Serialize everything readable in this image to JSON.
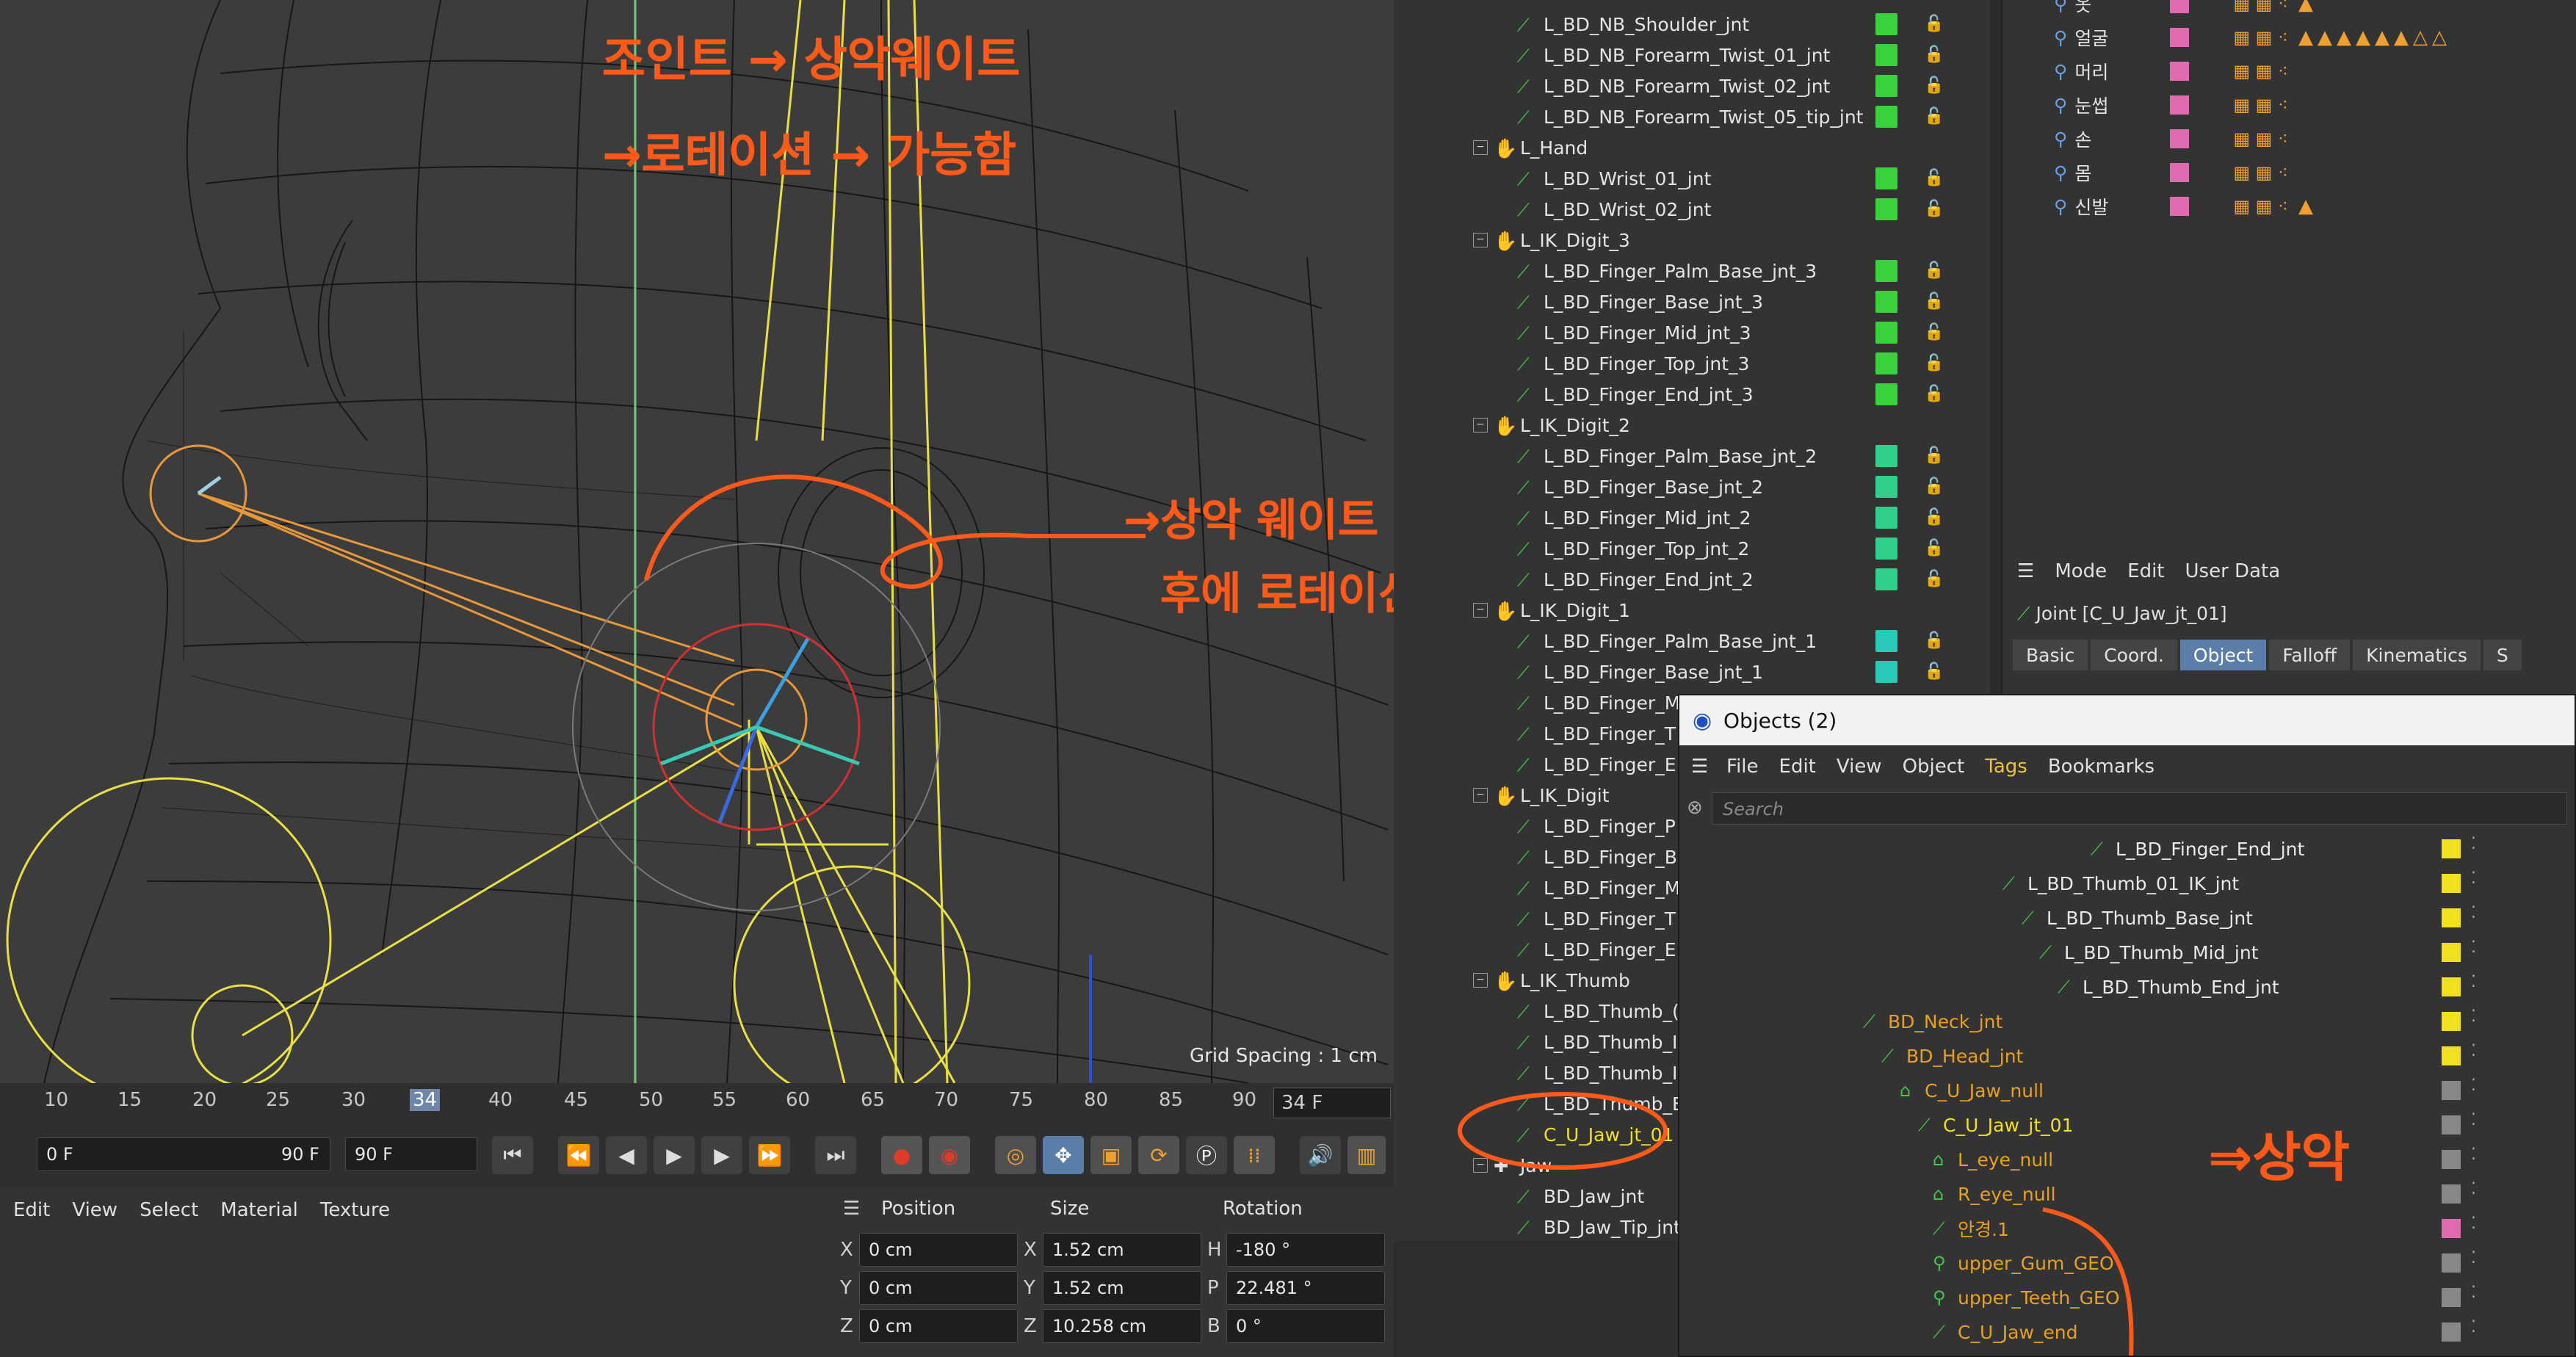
{
  "viewport": {
    "grid_spacing": "Grid Spacing : 1 cm"
  },
  "timeline": {
    "ticks": [
      "10",
      "15",
      "20",
      "25",
      "30",
      "34",
      "40",
      "45",
      "50",
      "55",
      "60",
      "65",
      "70",
      "75",
      "80",
      "85",
      "90"
    ],
    "current_frame": "34 F"
  },
  "transport": {
    "start_field": "0 F",
    "range_end": "90 F",
    "end_field": "90 F"
  },
  "material_menu": [
    "Edit",
    "View",
    "Select",
    "Material",
    "Texture"
  ],
  "coords": {
    "headers": [
      "Position",
      "Size",
      "Rotation"
    ],
    "rows": [
      {
        "axis": "X",
        "pos": "0 cm",
        "size_axis": "X",
        "size": "1.52 cm",
        "rot_axis": "H",
        "rot": "-180 °"
      },
      {
        "axis": "Y",
        "pos": "0 cm",
        "size_axis": "Y",
        "size": "1.52 cm",
        "rot_axis": "P",
        "rot": "22.481 °"
      },
      {
        "axis": "Z",
        "pos": "0 cm",
        "size_axis": "Z",
        "size": "10.258 cm",
        "rot_axis": "B",
        "rot": "0 °"
      }
    ]
  },
  "object_tree": [
    {
      "label": "L_BD_NB_Shoulder_jnt",
      "type": "bone",
      "vis": "#39d23c"
    },
    {
      "label": "L_BD_NB_Forearm_Twist_01_jnt",
      "type": "bone",
      "vis": "#39d23c"
    },
    {
      "label": "L_BD_NB_Forearm_Twist_02_jnt",
      "type": "bone",
      "vis": "#39d23c"
    },
    {
      "label": "L_BD_NB_Forearm_Twist_05_tip_jnt",
      "type": "bone",
      "vis": "#39d23c"
    },
    {
      "label": "L_Hand",
      "type": "hand",
      "vis": ""
    },
    {
      "label": "L_BD_Wrist_01_jnt",
      "type": "bone",
      "vis": "#39d23c"
    },
    {
      "label": "L_BD_Wrist_02_jnt",
      "type": "bone",
      "vis": "#39d23c"
    },
    {
      "label": "L_IK_Digit_3",
      "type": "hand",
      "vis": ""
    },
    {
      "label": "L_BD_Finger_Palm_Base_jnt_3",
      "type": "bone",
      "vis": "#39d23c"
    },
    {
      "label": "L_BD_Finger_Base_jnt_3",
      "type": "bone",
      "vis": "#39d23c"
    },
    {
      "label": "L_BD_Finger_Mid_jnt_3",
      "type": "bone",
      "vis": "#39d23c"
    },
    {
      "label": "L_BD_Finger_Top_jnt_3",
      "type": "bone",
      "vis": "#39d23c"
    },
    {
      "label": "L_BD_Finger_End_jnt_3",
      "type": "bone",
      "vis": "#39d23c"
    },
    {
      "label": "L_IK_Digit_2",
      "type": "hand",
      "vis": ""
    },
    {
      "label": "L_BD_Finger_Palm_Base_jnt_2",
      "type": "bone",
      "vis": "#2fd08a"
    },
    {
      "label": "L_BD_Finger_Base_jnt_2",
      "type": "bone",
      "vis": "#2fd08a"
    },
    {
      "label": "L_BD_Finger_Mid_jnt_2",
      "type": "bone",
      "vis": "#2fd08a"
    },
    {
      "label": "L_BD_Finger_Top_jnt_2",
      "type": "bone",
      "vis": "#2fd08a"
    },
    {
      "label": "L_BD_Finger_End_jnt_2",
      "type": "bone",
      "vis": "#2fd08a"
    },
    {
      "label": "L_IK_Digit_1",
      "type": "hand",
      "vis": ""
    },
    {
      "label": "L_BD_Finger_Palm_Base_jnt_1",
      "type": "bone",
      "vis": "#28c9b8"
    },
    {
      "label": "L_BD_Finger_Base_jnt_1",
      "type": "bone",
      "vis": "#28c9b8"
    },
    {
      "label": "L_BD_Finger_M",
      "type": "bone",
      "vis": ""
    },
    {
      "label": "L_BD_Finger_T",
      "type": "bone",
      "vis": ""
    },
    {
      "label": "L_BD_Finger_E",
      "type": "bone",
      "vis": ""
    },
    {
      "label": "L_IK_Digit",
      "type": "hand",
      "vis": ""
    },
    {
      "label": "L_BD_Finger_P",
      "type": "bone",
      "vis": ""
    },
    {
      "label": "L_BD_Finger_B",
      "type": "bone",
      "vis": ""
    },
    {
      "label": "L_BD_Finger_M",
      "type": "bone",
      "vis": ""
    },
    {
      "label": "L_BD_Finger_T",
      "type": "bone",
      "vis": ""
    },
    {
      "label": "L_BD_Finger_E",
      "type": "bone",
      "vis": ""
    },
    {
      "label": "L_IK_Thumb",
      "type": "hand",
      "vis": ""
    },
    {
      "label": "L_BD_Thumb_(",
      "type": "bone",
      "vis": ""
    },
    {
      "label": "L_BD_Thumb_I",
      "type": "bone",
      "vis": ""
    },
    {
      "label": "L_BD_Thumb_I",
      "type": "bone",
      "vis": ""
    },
    {
      "label": "L_BD_Thumb_E",
      "type": "bone",
      "vis": ""
    },
    {
      "label": "C_U_Jaw_jt_01",
      "type": "bone",
      "vis": ""
    },
    {
      "label": "Jaw",
      "type": "null",
      "vis": ""
    },
    {
      "label": "BD_Jaw_jnt",
      "type": "bone",
      "vis": ""
    },
    {
      "label": "BD_Jaw_Tip_jnt",
      "type": "bone",
      "vis": ""
    }
  ],
  "layers": [
    {
      "label": "옷"
    },
    {
      "label": "얼굴"
    },
    {
      "label": "머리"
    },
    {
      "label": "눈썹"
    },
    {
      "label": "손"
    },
    {
      "label": "몸"
    },
    {
      "label": "신발"
    }
  ],
  "attributes": {
    "menu": [
      "Mode",
      "Edit",
      "User Data"
    ],
    "title": "Joint [C_U_Jaw_jt_01]",
    "tabs": [
      "Basic",
      "Coord.",
      "Object",
      "Falloff",
      "Kinematics",
      "S"
    ],
    "active_tab": "Object"
  },
  "objects_window": {
    "title": "Objects (2)",
    "menu": [
      "File",
      "Edit",
      "View",
      "Object",
      "Tags",
      "Bookmarks"
    ],
    "search_placeholder": "Search",
    "rows": [
      {
        "label": "L_BD_Finger_End_jnt",
        "color": "#e8e8e8",
        "dot": "#f0e020"
      },
      {
        "label": "L_BD_Thumb_01_IK_jnt",
        "color": "#e8e8e8",
        "dot": "#f0e020"
      },
      {
        "label": "L_BD_Thumb_Base_jnt",
        "color": "#e8e8e8",
        "dot": "#f0e020"
      },
      {
        "label": "L_BD_Thumb_Mid_jnt",
        "color": "#e8e8e8",
        "dot": "#f0e020"
      },
      {
        "label": "L_BD_Thumb_End_jnt",
        "color": "#e8e8e8",
        "dot": "#f0e020"
      },
      {
        "label": "BD_Neck_jnt",
        "color": "#e8a020",
        "dot": "#f0e020"
      },
      {
        "label": "BD_Head_jnt",
        "color": "#e8a020",
        "dot": "#f0e020"
      },
      {
        "label": "C_U_Jaw_null",
        "color": "#e8a020",
        "dot": "#888"
      },
      {
        "label": "C_U_Jaw_jt_01",
        "color": "#f0e020",
        "dot": "#888"
      },
      {
        "label": "L_eye_null",
        "color": "#e8a020",
        "dot": "#888"
      },
      {
        "label": "R_eye_null",
        "color": "#e8a020",
        "dot": "#888"
      },
      {
        "label": "안경.1",
        "color": "#e8a020",
        "dot": "#e06ab0"
      },
      {
        "label": "upper_Gum_GEO",
        "color": "#e8a020",
        "dot": "#888"
      },
      {
        "label": "upper_Teeth_GEO",
        "color": "#e8a020",
        "dot": "#888"
      },
      {
        "label": "C_U_Jaw_end",
        "color": "#e8a020",
        "dot": "#888"
      }
    ]
  },
  "annotations": {
    "line1": "조인트 → 상악웨이트",
    "line2": "→로테이션 → 가능함",
    "mid1": "→상악 웨이트",
    "mid2": "후에 로테이션",
    "right": "⇒상악"
  }
}
